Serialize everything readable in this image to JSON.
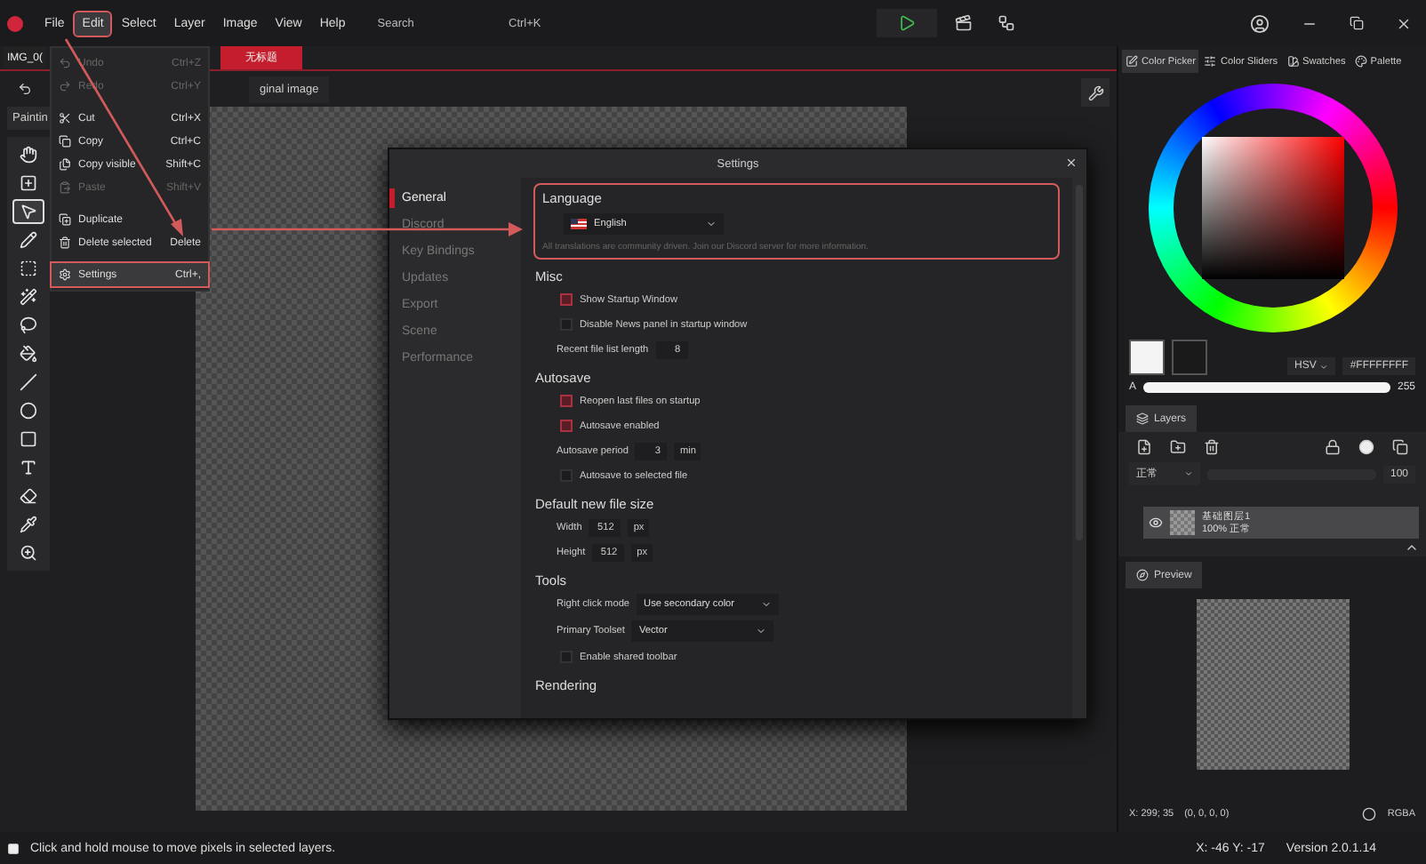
{
  "menu_bar": {
    "items": [
      {
        "label": "File",
        "selected": false
      },
      {
        "label": "Edit",
        "selected": true
      },
      {
        "label": "Select",
        "selected": false
      },
      {
        "label": "Layer",
        "selected": false
      },
      {
        "label": "Image",
        "selected": false
      },
      {
        "label": "View",
        "selected": false
      },
      {
        "label": "Help",
        "selected": false
      }
    ],
    "search": {
      "placeholder": "Search",
      "shortcut": "Ctrl+K"
    }
  },
  "document_tabs": [
    {
      "label": "IMG_0(",
      "selected": false
    },
    {
      "label": "无标题",
      "selected": true
    }
  ],
  "canvas_tab": {
    "label": "ginal image"
  },
  "tool_panel": {
    "tab": "Paintin",
    "tools": [
      {
        "selected": false
      },
      {
        "selected": false
      },
      {
        "selected": true
      },
      {
        "selected": false
      },
      {
        "selected": false
      },
      {
        "selected": false
      },
      {
        "selected": false
      },
      {
        "selected": false
      },
      {
        "selected": false
      },
      {
        "selected": false
      },
      {
        "selected": false
      },
      {
        "selected": false
      },
      {
        "selected": false
      },
      {
        "selected": false
      },
      {
        "selected": false
      }
    ]
  },
  "edit_menu": [
    {
      "label": "Undo",
      "shortcut": "Ctrl+Z",
      "disabled": true,
      "selected": false
    },
    {
      "label": "Redo",
      "shortcut": "Ctrl+Y",
      "disabled": true,
      "selected": false
    },
    {
      "label": "Cut",
      "shortcut": "Ctrl+X",
      "disabled": false,
      "selected": false
    },
    {
      "label": "Copy",
      "shortcut": "Ctrl+C",
      "disabled": false,
      "selected": false
    },
    {
      "label": "Copy visible",
      "shortcut": "Shift+C",
      "disabled": false,
      "selected": false
    },
    {
      "label": "Paste",
      "shortcut": "Shift+V",
      "disabled": true,
      "selected": false
    },
    {
      "label": "Duplicate",
      "disabled": false,
      "selected": false
    },
    {
      "label": "Delete selected",
      "shortcut": "Delete",
      "disabled": false,
      "selected": false
    },
    {
      "label": "Settings",
      "shortcut": "Ctrl+,",
      "disabled": false,
      "selected": true
    }
  ],
  "settings": {
    "title": "Settings",
    "nav": [
      {
        "label": "General",
        "selected": true
      },
      {
        "label": "Discord",
        "selected": false
      },
      {
        "label": "Key Bindings",
        "selected": false
      },
      {
        "label": "Updates",
        "selected": false
      },
      {
        "label": "Export",
        "selected": false
      },
      {
        "label": "Scene",
        "selected": false
      },
      {
        "label": "Performance",
        "selected": false
      }
    ],
    "language": {
      "heading": "Language",
      "value": "English",
      "note": "All translations are community driven. Join our Discord server for more information."
    },
    "sections": [
      {
        "heading": "Misc",
        "rows": [
          {
            "kind": "checkbox",
            "label": "Show Startup Window",
            "checked": true
          },
          {
            "kind": "checkbox",
            "label": "Disable News panel in startup window",
            "checked": false
          },
          {
            "kind": "number",
            "label": "Recent file list length",
            "value": "8"
          }
        ]
      },
      {
        "heading": "Autosave",
        "rows": [
          {
            "kind": "checkbox",
            "label": "Reopen last files on startup",
            "checked": true
          },
          {
            "kind": "checkbox",
            "label": "Autosave enabled",
            "checked": true
          },
          {
            "kind": "number",
            "label": "Autosave period",
            "value": "3",
            "unit": "min"
          },
          {
            "kind": "checkbox",
            "label": "Autosave to selected file",
            "checked": false
          }
        ]
      },
      {
        "heading": "Default new file size",
        "rows": [
          {
            "kind": "number",
            "label": "Width",
            "value": "512",
            "unit": "px"
          },
          {
            "kind": "number",
            "label": "Height",
            "value": "512",
            "unit": "px"
          }
        ]
      },
      {
        "heading": "Tools",
        "rows": [
          {
            "kind": "select",
            "label": "Right click mode",
            "value": "Use secondary color"
          },
          {
            "kind": "select",
            "label": "Primary Toolset",
            "value": "Vector"
          },
          {
            "kind": "checkbox",
            "label": "Enable shared toolbar",
            "checked": false
          }
        ]
      },
      {
        "heading": "Rendering"
      }
    ]
  },
  "right_panel": {
    "tabs": [
      {
        "label": "Color Picker",
        "selected": true
      },
      {
        "label": "Color Sliders",
        "selected": false
      },
      {
        "label": "Swatches",
        "selected": false
      },
      {
        "label": "Palette",
        "selected": false
      }
    ],
    "color_mode": "HSV",
    "hex": "#FFFFFFFF",
    "alpha": {
      "label": "A",
      "level": 1,
      "reading": "255"
    },
    "layers": {
      "tab": "Layers",
      "blend_mode": "正常",
      "opacity": {
        "level": 1,
        "reading": "100"
      },
      "items": [
        {
          "name": "基础图层1",
          "info": "100% 正常",
          "visible": true,
          "selected": true
        }
      ]
    },
    "preview": {
      "tab": "Preview",
      "coords": "X: 299; 35",
      "pixel": "(0, 0, 0, 0)",
      "format": "RGBA"
    }
  },
  "status_bar": {
    "hint": "Click and hold mouse to move pixels in selected layers.",
    "position": "X: -46 Y: -17",
    "version": "Version 2.0.1.14"
  }
}
